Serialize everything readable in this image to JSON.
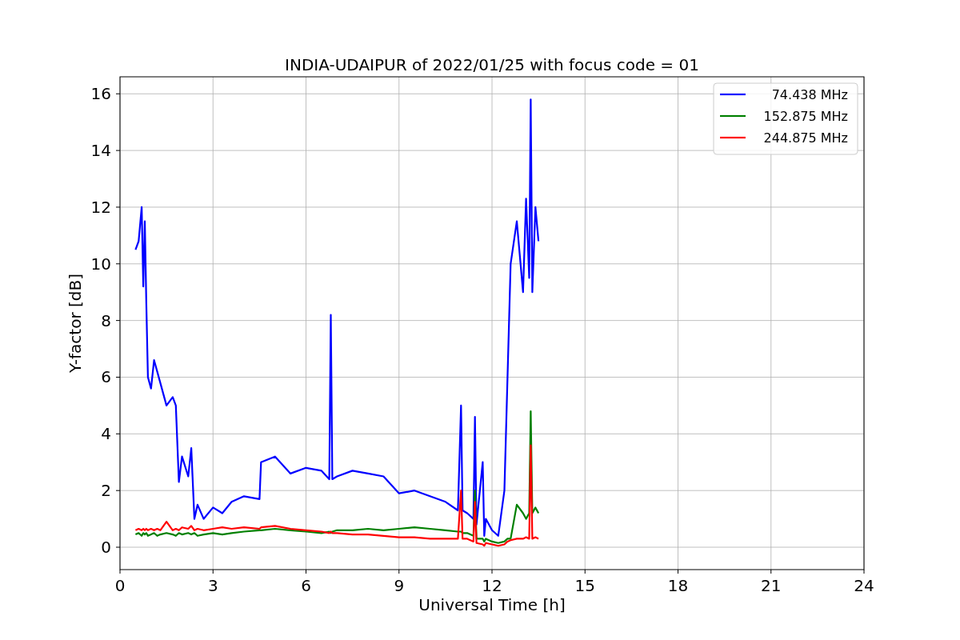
{
  "chart_data": {
    "type": "line",
    "title": "INDIA-UDAIPUR of 2022/01/25 with focus code = 01",
    "xlabel": "Universal Time [h]",
    "ylabel": "Y-factor [dB]",
    "x": [
      0.5,
      0.6,
      0.7,
      0.75,
      0.8,
      0.85,
      0.9,
      1.0,
      1.1,
      1.2,
      1.3,
      1.5,
      1.7,
      1.8,
      1.9,
      2.0,
      2.2,
      2.3,
      2.4,
      2.5,
      2.7,
      3.0,
      3.3,
      3.6,
      4.0,
      4.5,
      4.55,
      5.0,
      5.5,
      6.0,
      6.5,
      6.75,
      6.8,
      6.85,
      7.0,
      7.5,
      8.0,
      8.5,
      9.0,
      9.5,
      10.0,
      10.5,
      10.9,
      11.0,
      11.05,
      11.2,
      11.4,
      11.45,
      11.5,
      11.7,
      11.75,
      11.8,
      12.0,
      12.2,
      12.4,
      12.5,
      12.6,
      12.8,
      13.0,
      13.1,
      13.2,
      13.25,
      13.3,
      13.4,
      13.5
    ],
    "series": [
      {
        "name": "74.438 MHz",
        "color": "#0000ff",
        "values": [
          10.5,
          10.8,
          12.0,
          9.2,
          11.5,
          8.6,
          6.0,
          5.6,
          6.6,
          6.2,
          5.8,
          5.0,
          5.3,
          5.0,
          2.3,
          3.2,
          2.5,
          3.5,
          1.0,
          1.5,
          1.0,
          1.4,
          1.2,
          1.6,
          1.8,
          1.7,
          3.0,
          3.2,
          2.6,
          2.8,
          2.7,
          2.4,
          8.2,
          2.4,
          2.5,
          2.7,
          2.6,
          2.5,
          1.9,
          2.0,
          1.8,
          1.6,
          1.3,
          5.0,
          1.3,
          1.2,
          1.0,
          4.6,
          0.8,
          3.0,
          0.4,
          1.0,
          0.6,
          0.4,
          2.0,
          6.0,
          10.0,
          11.5,
          9.0,
          12.3,
          9.5,
          15.8,
          9.0,
          12.0,
          10.8
        ]
      },
      {
        "name": "152.875 MHz",
        "color": "#008000",
        "values": [
          0.45,
          0.5,
          0.4,
          0.5,
          0.45,
          0.5,
          0.4,
          0.45,
          0.5,
          0.4,
          0.45,
          0.5,
          0.45,
          0.4,
          0.5,
          0.45,
          0.5,
          0.45,
          0.5,
          0.4,
          0.45,
          0.5,
          0.45,
          0.5,
          0.55,
          0.6,
          0.6,
          0.65,
          0.6,
          0.55,
          0.5,
          0.55,
          0.5,
          0.55,
          0.6,
          0.6,
          0.65,
          0.6,
          0.65,
          0.7,
          0.65,
          0.6,
          0.55,
          0.55,
          0.5,
          0.5,
          0.4,
          2.0,
          0.3,
          0.3,
          0.2,
          0.3,
          0.2,
          0.15,
          0.2,
          0.3,
          0.3,
          1.5,
          1.2,
          1.0,
          1.2,
          4.8,
          1.2,
          1.4,
          1.2
        ]
      },
      {
        "name": "244.875 MHz",
        "color": "#ff0000",
        "values": [
          0.6,
          0.65,
          0.6,
          0.65,
          0.6,
          0.65,
          0.6,
          0.65,
          0.6,
          0.65,
          0.6,
          0.9,
          0.6,
          0.65,
          0.6,
          0.7,
          0.65,
          0.75,
          0.6,
          0.65,
          0.6,
          0.65,
          0.7,
          0.65,
          0.7,
          0.65,
          0.7,
          0.75,
          0.65,
          0.6,
          0.55,
          0.5,
          0.55,
          0.5,
          0.5,
          0.45,
          0.45,
          0.4,
          0.35,
          0.35,
          0.3,
          0.3,
          0.3,
          2.0,
          0.3,
          0.3,
          0.2,
          1.6,
          0.15,
          0.1,
          0.05,
          0.15,
          0.1,
          0.05,
          0.1,
          0.2,
          0.25,
          0.3,
          0.3,
          0.35,
          0.3,
          3.6,
          0.3,
          0.35,
          0.3
        ]
      }
    ],
    "grid": true,
    "legend": true,
    "xlim": [
      0,
      24
    ],
    "ylim": [
      -0.79,
      16.6
    ],
    "xticks": [
      0,
      3,
      6,
      9,
      12,
      15,
      18,
      21,
      24
    ],
    "yticks": [
      0,
      2,
      4,
      6,
      8,
      10,
      12,
      14,
      16
    ]
  }
}
